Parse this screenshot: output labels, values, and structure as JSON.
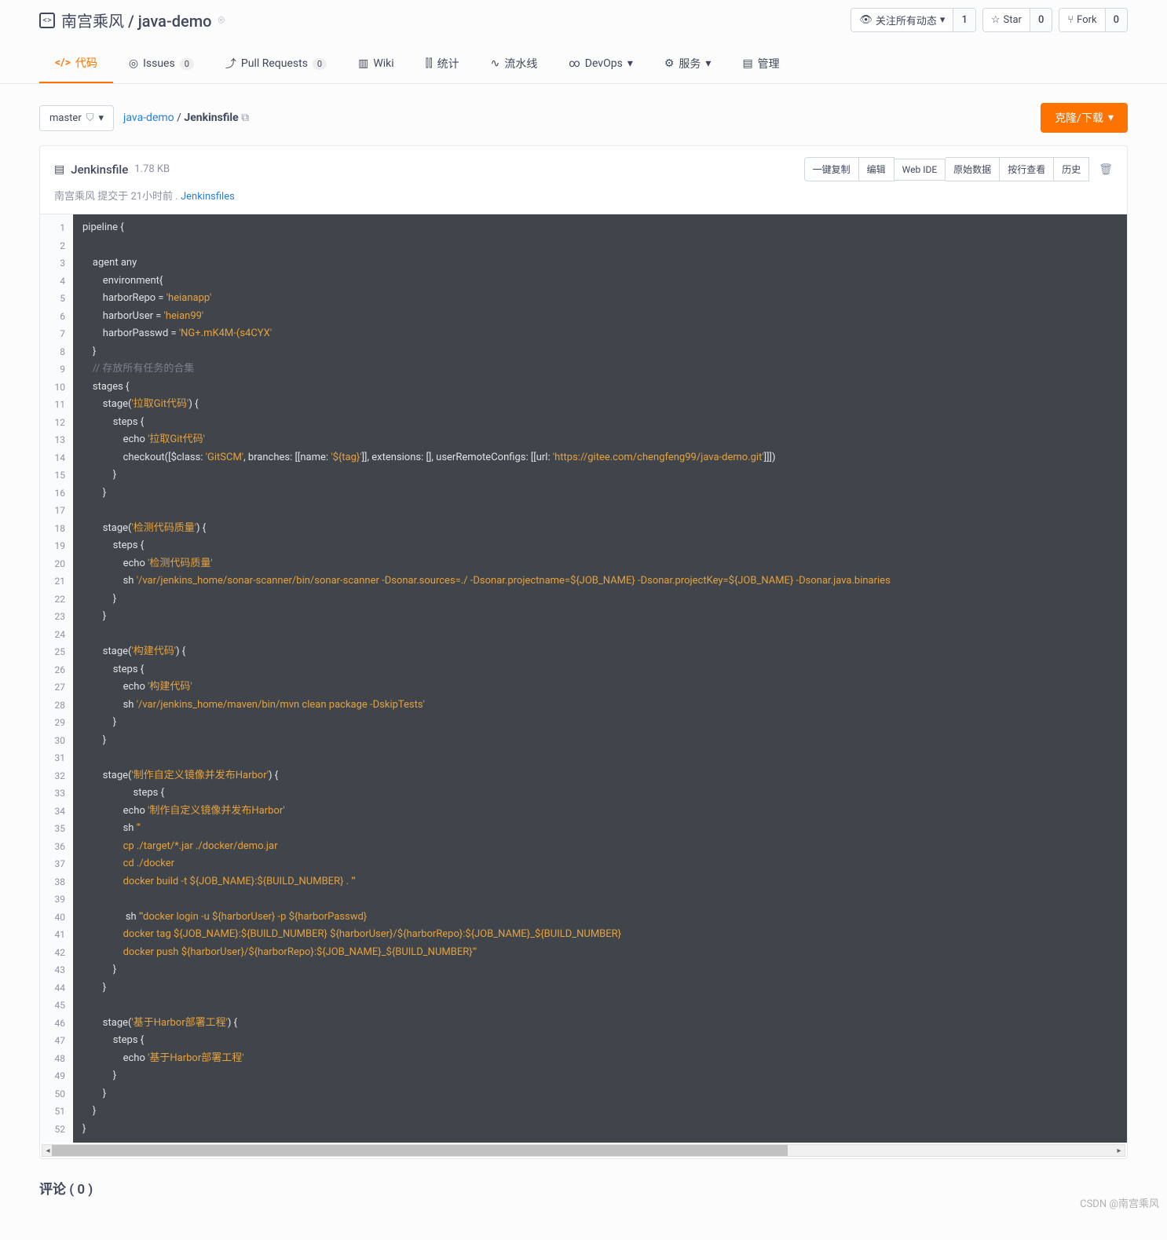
{
  "header": {
    "owner": "南宫乘风",
    "repo": "java-demo",
    "watch_label": "关注所有动态",
    "watch_count": "1",
    "star_label": "Star",
    "star_count": "0",
    "fork_label": "Fork",
    "fork_count": "0"
  },
  "tabs": {
    "code": "代码",
    "issues": "Issues",
    "issues_count": "0",
    "pr": "Pull Requests",
    "pr_count": "0",
    "wiki": "Wiki",
    "stats": "统计",
    "pipeline": "流水线",
    "devops": "DevOps",
    "service": "服务",
    "manage": "管理"
  },
  "toolbar": {
    "branch": "master",
    "bc_root": "java-demo",
    "bc_sep": "/",
    "bc_file": "Jenkinsfile",
    "clone": "克隆/下载"
  },
  "filehead": {
    "name": "Jenkinsfile",
    "size": "1.78 KB",
    "commit_prefix": "南宫乘风 提交于 21小时前 . ",
    "commit_msg": "Jenkinsfiles",
    "btn_copy": "一键复制",
    "btn_edit": "编辑",
    "btn_webide": "Web IDE",
    "btn_raw": "原始数据",
    "btn_blame": "按行查看",
    "btn_history": "历史"
  },
  "code": {
    "lines": [
      [
        {
          "t": "pipeline {",
          "c": "kw"
        }
      ],
      [],
      [
        {
          "t": "    agent any",
          "c": "kw"
        }
      ],
      [
        {
          "t": "        environment{",
          "c": "kw"
        }
      ],
      [
        {
          "t": "        harborRepo = ",
          "c": "kw"
        },
        {
          "t": "'heianapp'",
          "c": "str"
        }
      ],
      [
        {
          "t": "        harborUser = ",
          "c": "kw"
        },
        {
          "t": "'heian99'",
          "c": "str"
        }
      ],
      [
        {
          "t": "        harborPasswd = ",
          "c": "kw"
        },
        {
          "t": "'NG+.mK4M-(s4CYX'",
          "c": "str"
        }
      ],
      [
        {
          "t": "    }",
          "c": "kw"
        }
      ],
      [
        {
          "t": "    // 存放所有任务的合集",
          "c": "cmt"
        }
      ],
      [
        {
          "t": "    stages {",
          "c": "kw"
        }
      ],
      [
        {
          "t": "        stage(",
          "c": "kw"
        },
        {
          "t": "'拉取Git代码'",
          "c": "str"
        },
        {
          "t": ") {",
          "c": "kw"
        }
      ],
      [
        {
          "t": "            steps {",
          "c": "kw"
        }
      ],
      [
        {
          "t": "                echo ",
          "c": "kw"
        },
        {
          "t": "'拉取Git代码'",
          "c": "str"
        }
      ],
      [
        {
          "t": "                checkout([$class: ",
          "c": "kw"
        },
        {
          "t": "'GitSCM'",
          "c": "str"
        },
        {
          "t": ", branches: [[name: ",
          "c": "kw"
        },
        {
          "t": "'${tag}'",
          "c": "str"
        },
        {
          "t": "]], extensions: [], userRemoteConfigs: [[url: ",
          "c": "kw"
        },
        {
          "t": "'https://gitee.com/chengfeng99/java-demo.git'",
          "c": "str"
        },
        {
          "t": "]]])",
          "c": "kw"
        }
      ],
      [
        {
          "t": "            }",
          "c": "kw"
        }
      ],
      [
        {
          "t": "        }",
          "c": "kw"
        }
      ],
      [],
      [
        {
          "t": "        stage(",
          "c": "kw"
        },
        {
          "t": "'检测代码质量'",
          "c": "str"
        },
        {
          "t": ") {",
          "c": "kw"
        }
      ],
      [
        {
          "t": "            steps {",
          "c": "kw"
        }
      ],
      [
        {
          "t": "                echo ",
          "c": "kw"
        },
        {
          "t": "'检测代码质量'",
          "c": "str"
        }
      ],
      [
        {
          "t": "                sh ",
          "c": "kw"
        },
        {
          "t": "'/var/jenkins_home/sonar-scanner/bin/sonar-scanner -Dsonar.sources=./ -Dsonar.projectname=${JOB_NAME} -Dsonar.projectKey=${JOB_NAME} -Dsonar.java.binaries",
          "c": "str"
        }
      ],
      [
        {
          "t": "            }",
          "c": "kw"
        }
      ],
      [
        {
          "t": "        }",
          "c": "kw"
        }
      ],
      [],
      [
        {
          "t": "        stage(",
          "c": "kw"
        },
        {
          "t": "'构建代码'",
          "c": "str"
        },
        {
          "t": ") {",
          "c": "kw"
        }
      ],
      [
        {
          "t": "            steps {",
          "c": "kw"
        }
      ],
      [
        {
          "t": "                echo ",
          "c": "kw"
        },
        {
          "t": "'构建代码'",
          "c": "str"
        }
      ],
      [
        {
          "t": "                sh ",
          "c": "kw"
        },
        {
          "t": "'/var/jenkins_home/maven/bin/mvn clean package -DskipTests'",
          "c": "str"
        }
      ],
      [
        {
          "t": "            }",
          "c": "kw"
        }
      ],
      [
        {
          "t": "        }",
          "c": "kw"
        }
      ],
      [],
      [
        {
          "t": "        stage(",
          "c": "kw"
        },
        {
          "t": "'制作自定义镜像并发布Harbor'",
          "c": "str"
        },
        {
          "t": ") {",
          "c": "kw"
        }
      ],
      [
        {
          "t": "                    steps {",
          "c": "kw"
        }
      ],
      [
        {
          "t": "                echo ",
          "c": "kw"
        },
        {
          "t": "'制作自定义镜像并发布Harbor'",
          "c": "str"
        }
      ],
      [
        {
          "t": "                sh ",
          "c": "kw"
        },
        {
          "t": "'''",
          "c": "str"
        }
      ],
      [
        {
          "t": "                cp ./target/*.jar ./docker/demo.jar",
          "c": "str"
        }
      ],
      [
        {
          "t": "                cd ./docker",
          "c": "str"
        }
      ],
      [
        {
          "t": "                docker build -t ${JOB_NAME}:${BUILD_NUMBER} . '''",
          "c": "str"
        }
      ],
      [],
      [
        {
          "t": "                 sh ",
          "c": "kw"
        },
        {
          "t": "'''docker login -u ${harborUser} -p ${harborPasswd}",
          "c": "str"
        }
      ],
      [
        {
          "t": "                docker tag ${JOB_NAME}:${BUILD_NUMBER} ${harborUser}/${harborRepo}:${JOB_NAME}_${BUILD_NUMBER}",
          "c": "str"
        }
      ],
      [
        {
          "t": "                docker push ${harborUser}/${harborRepo}:${JOB_NAME}_${BUILD_NUMBER}'''",
          "c": "str"
        }
      ],
      [
        {
          "t": "            }",
          "c": "kw"
        }
      ],
      [
        {
          "t": "        }",
          "c": "kw"
        }
      ],
      [],
      [
        {
          "t": "        stage(",
          "c": "kw"
        },
        {
          "t": "'基于Harbor部署工程'",
          "c": "str"
        },
        {
          "t": ") {",
          "c": "kw"
        }
      ],
      [
        {
          "t": "            steps {",
          "c": "kw"
        }
      ],
      [
        {
          "t": "                echo ",
          "c": "kw"
        },
        {
          "t": "'基于Harbor部署工程'",
          "c": "str"
        }
      ],
      [
        {
          "t": "            }",
          "c": "kw"
        }
      ],
      [
        {
          "t": "        }",
          "c": "kw"
        }
      ],
      [
        {
          "t": "    }",
          "c": "kw"
        }
      ],
      [
        {
          "t": "}",
          "c": "kw"
        }
      ]
    ]
  },
  "comments": {
    "label": "评论 ( 0 )"
  },
  "watermark": "CSDN @南宫乘风"
}
